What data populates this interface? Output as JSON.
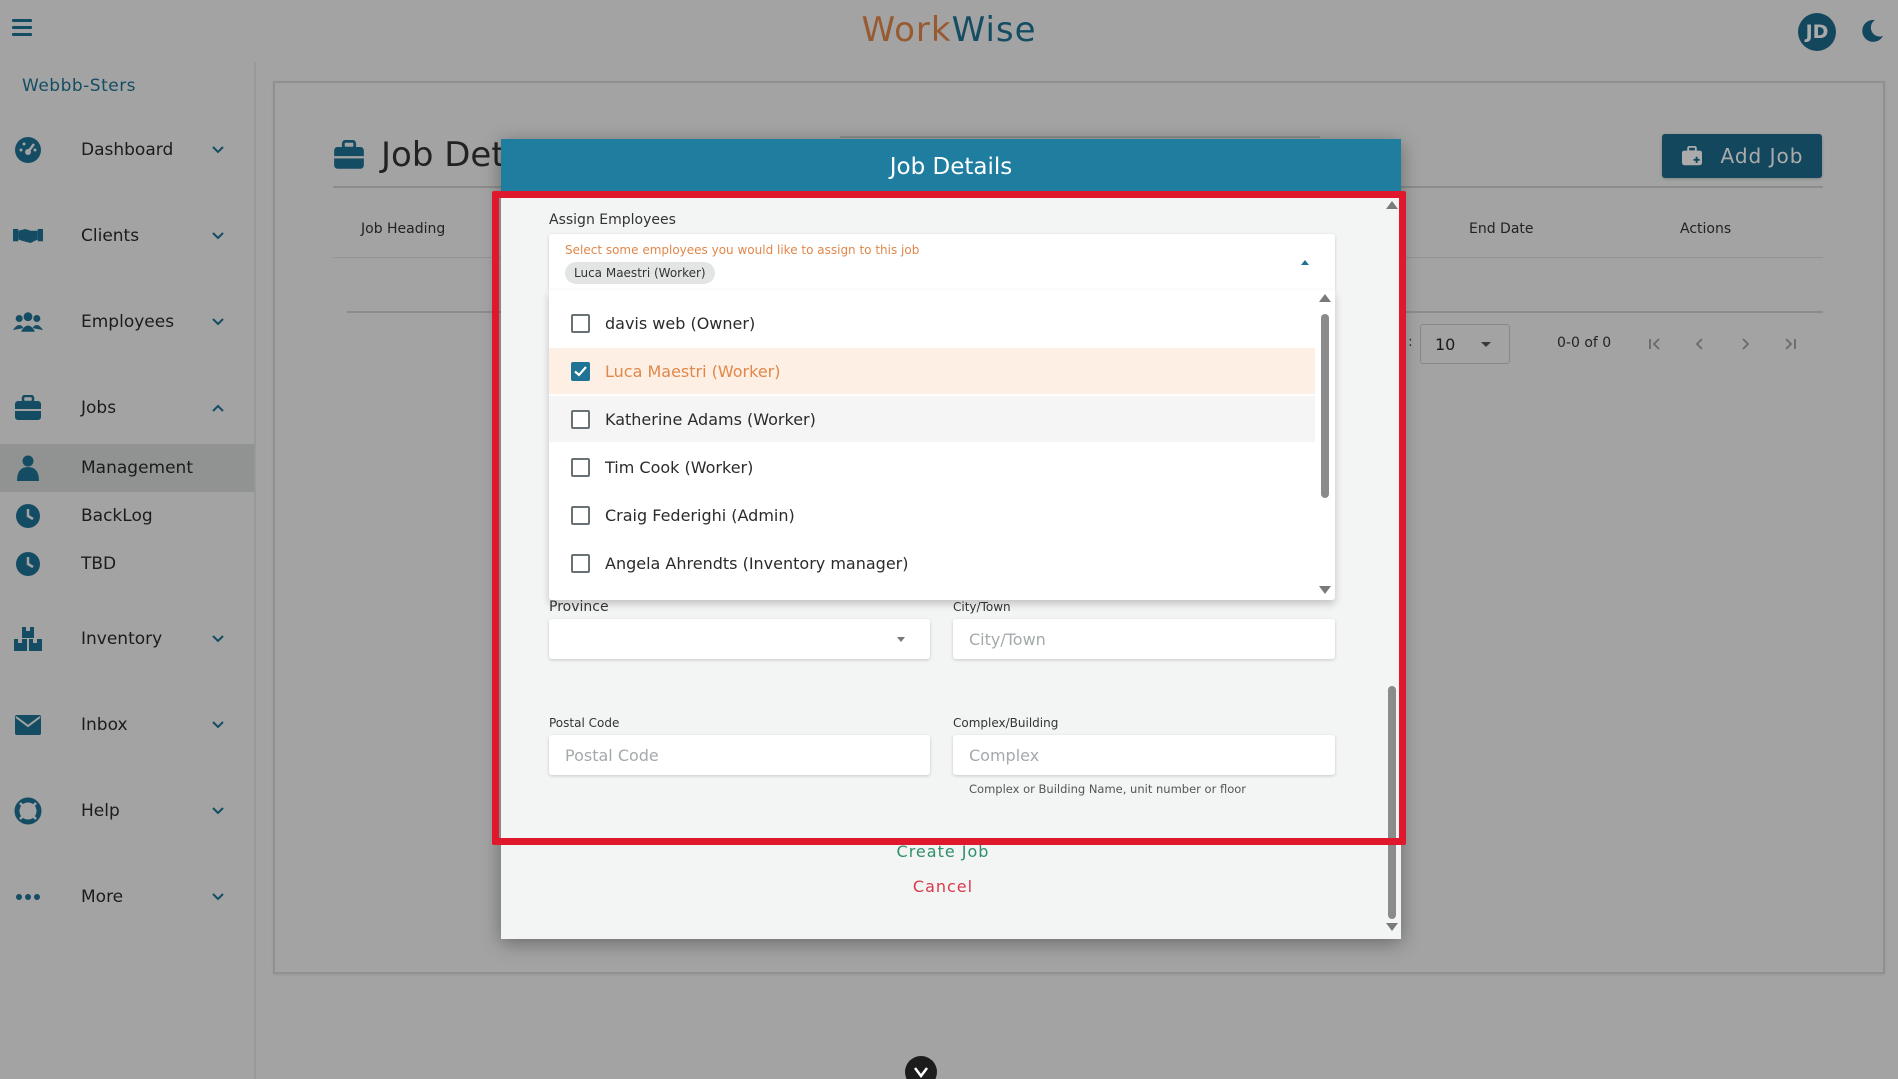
{
  "app": {
    "brand_part1": "Work",
    "brand_part2": "Wise",
    "avatar_initials": "JD"
  },
  "sidebar": {
    "org_name": "Webbb-Sters",
    "items": [
      {
        "label": "Dashboard",
        "icon": "dashboard-icon"
      },
      {
        "label": "Clients",
        "icon": "handshake-icon"
      },
      {
        "label": "Employees",
        "icon": "users-icon"
      },
      {
        "label": "Jobs",
        "icon": "briefcase-icon"
      },
      {
        "label": "Management",
        "icon": "person-icon"
      },
      {
        "label": "BackLog",
        "icon": "clock-icon"
      },
      {
        "label": "TBD",
        "icon": "clock-icon"
      },
      {
        "label": "Inventory",
        "icon": "boxes-icon"
      },
      {
        "label": "Inbox",
        "icon": "envelope-icon"
      },
      {
        "label": "Help",
        "icon": "lifebuoy-icon"
      },
      {
        "label": "More",
        "icon": "dots-icon"
      }
    ]
  },
  "page": {
    "title": "Job Det",
    "add_job_label": "Add Job",
    "columns": [
      "Job Heading",
      "End Date",
      "Actions"
    ],
    "rows_per_page_colon": ":",
    "rows_per_page": "10",
    "pagination_count": "0-0 of 0"
  },
  "modal": {
    "title": "Job Details",
    "assign_label": "Assign Employees",
    "assign_hint": "Select some employees you would like to assign to this job",
    "selected_chip": "Luca Maestri (Worker)",
    "options": [
      {
        "label": "davis web (Owner)",
        "checked": false
      },
      {
        "label": "Luca Maestri (Worker)",
        "checked": true
      },
      {
        "label": "Katherine Adams (Worker)",
        "checked": false
      },
      {
        "label": "Tim Cook (Worker)",
        "checked": false
      },
      {
        "label": "Craig Federighi (Admin)",
        "checked": false
      },
      {
        "label": "Angela Ahrendts (Inventory manager)",
        "checked": false
      }
    ],
    "province_label": "Province",
    "city_label": "City/Town",
    "city_placeholder": "City/Town",
    "postal_label": "Postal Code",
    "postal_placeholder": "Postal Code",
    "complex_label": "Complex/Building",
    "complex_placeholder": "Complex",
    "complex_helper": "Complex or Building Name, unit number or floor",
    "create_label": "Create Job",
    "cancel_label": "Cancel"
  },
  "colors": {
    "primary": "#1f7394",
    "accent": "#e1874a",
    "header": "#1f7e9f",
    "danger": "#d9394a",
    "success": "#2f8f6a",
    "highlight": "#e0182d"
  }
}
